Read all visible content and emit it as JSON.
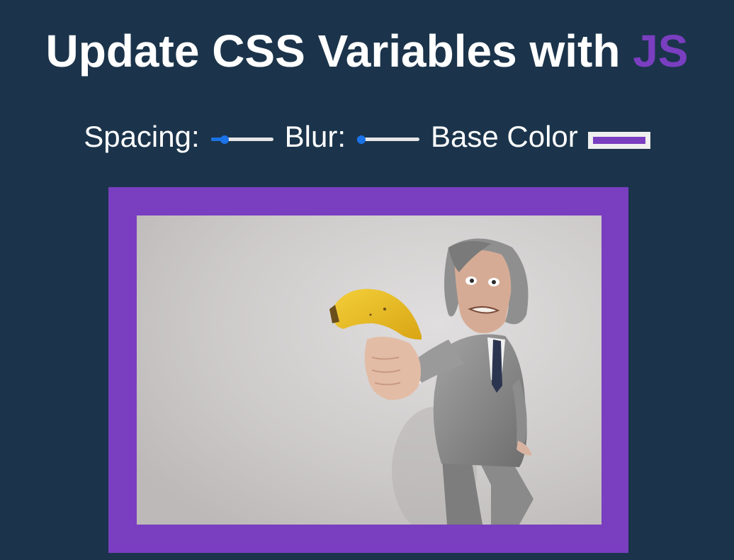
{
  "header": {
    "title_main": "Update CSS Variables with ",
    "title_highlight": "JS"
  },
  "controls": {
    "spacing": {
      "label": "Spacing:",
      "value_fraction": 0.22
    },
    "blur": {
      "label": "Blur:",
      "value_fraction": 0.02
    },
    "base_color": {
      "label": "Base Color",
      "value": "#7a3ec0"
    }
  },
  "image": {
    "alt": "man in grey suit pointing a banana like a gun"
  },
  "colors": {
    "background": "#1b344b",
    "base": "#7a3ec0",
    "slider_accent": "#1a73e8"
  }
}
